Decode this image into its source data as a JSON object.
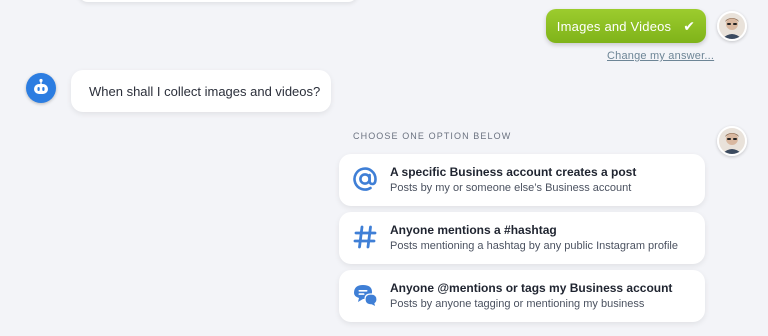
{
  "user_answer": {
    "label": "Images and Videos",
    "check_icon": "checkmark-icon"
  },
  "change_answer_link": "Change my answer...",
  "bot_question": "When shall I collect images and videos?",
  "options_header": "CHOOSE ONE OPTION BELOW",
  "options": [
    {
      "title": "A specific Business account creates a post",
      "subtitle": "Posts by my or someone else’s Business account",
      "icon": "at-sign-icon"
    },
    {
      "title": "Anyone mentions a #hashtag",
      "subtitle": "Posts mentioning a hashtag by any public Instagram profile",
      "icon": "hashtag-icon"
    },
    {
      "title": "Anyone @mentions or tags my Business account",
      "subtitle": "Posts by anyone tagging or mentioning my business",
      "icon": "chat-bubbles-icon"
    }
  ],
  "colors": {
    "accent_green": "#8bc220",
    "bot_blue": "#2c7de1",
    "icon_blue": "#3f7fd6",
    "background": "#f3f4f8"
  }
}
